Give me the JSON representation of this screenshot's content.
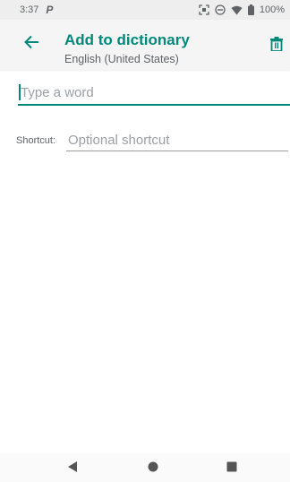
{
  "status_bar": {
    "time": "3:37",
    "notification_letter": "P",
    "battery": "100%"
  },
  "app_bar": {
    "title": "Add to dictionary",
    "subtitle": "English (United States)",
    "back_icon": "arrow-back-icon",
    "delete_icon": "trash-icon"
  },
  "form": {
    "word": {
      "value": "",
      "placeholder": "Type a word"
    },
    "shortcut": {
      "label": "Shortcut:",
      "value": "",
      "placeholder": "Optional shortcut"
    }
  },
  "nav_bar": {
    "icons": [
      "nav-back-icon",
      "nav-home-icon",
      "nav-recents-icon"
    ]
  },
  "colors": {
    "accent": "#00897b",
    "status_bar_bg": "#eeeeee",
    "app_bar_bg": "#f5f5f5",
    "hint_text": "#9aa0a6"
  }
}
